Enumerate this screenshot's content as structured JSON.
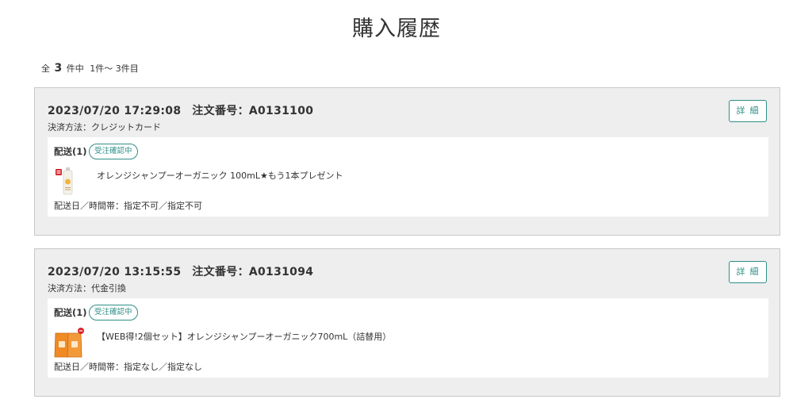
{
  "page": {
    "title": "購入履歴"
  },
  "summary": {
    "prefix": "全",
    "total": "3",
    "suffix": "件中",
    "range": "1件〜 3件目"
  },
  "colors": {
    "accent": "#2f8f87",
    "card_bg": "#eeeeee",
    "card_border": "#c8c8c8"
  },
  "orders": [
    {
      "datetime": "2023/07/20 17:29:08",
      "order_number": "注文番号：A0131100",
      "payment": "決済方法：クレジットカード",
      "detail_label": "詳細",
      "shipping_label": "配送(1)",
      "status": "受注確認中",
      "product": "オレンジシャンプーオーガニック 100mL★もう1本プレゼント",
      "product_icon": "shampoo-bottle-icon",
      "delivery": "配送日／時間帯：指定不可／指定不可"
    },
    {
      "datetime": "2023/07/20 13:15:55",
      "order_number": "注文番号：A0131094",
      "payment": "決済方法：代金引換",
      "detail_label": "詳細",
      "shipping_label": "配送(1)",
      "status": "受注確認中",
      "product": "【WEB得!2個セット】オレンジシャンプーオーガニック700mL（詰替用）",
      "product_icon": "refill-pouch-icon",
      "delivery": "配送日／時間帯：指定なし／指定なし"
    }
  ]
}
